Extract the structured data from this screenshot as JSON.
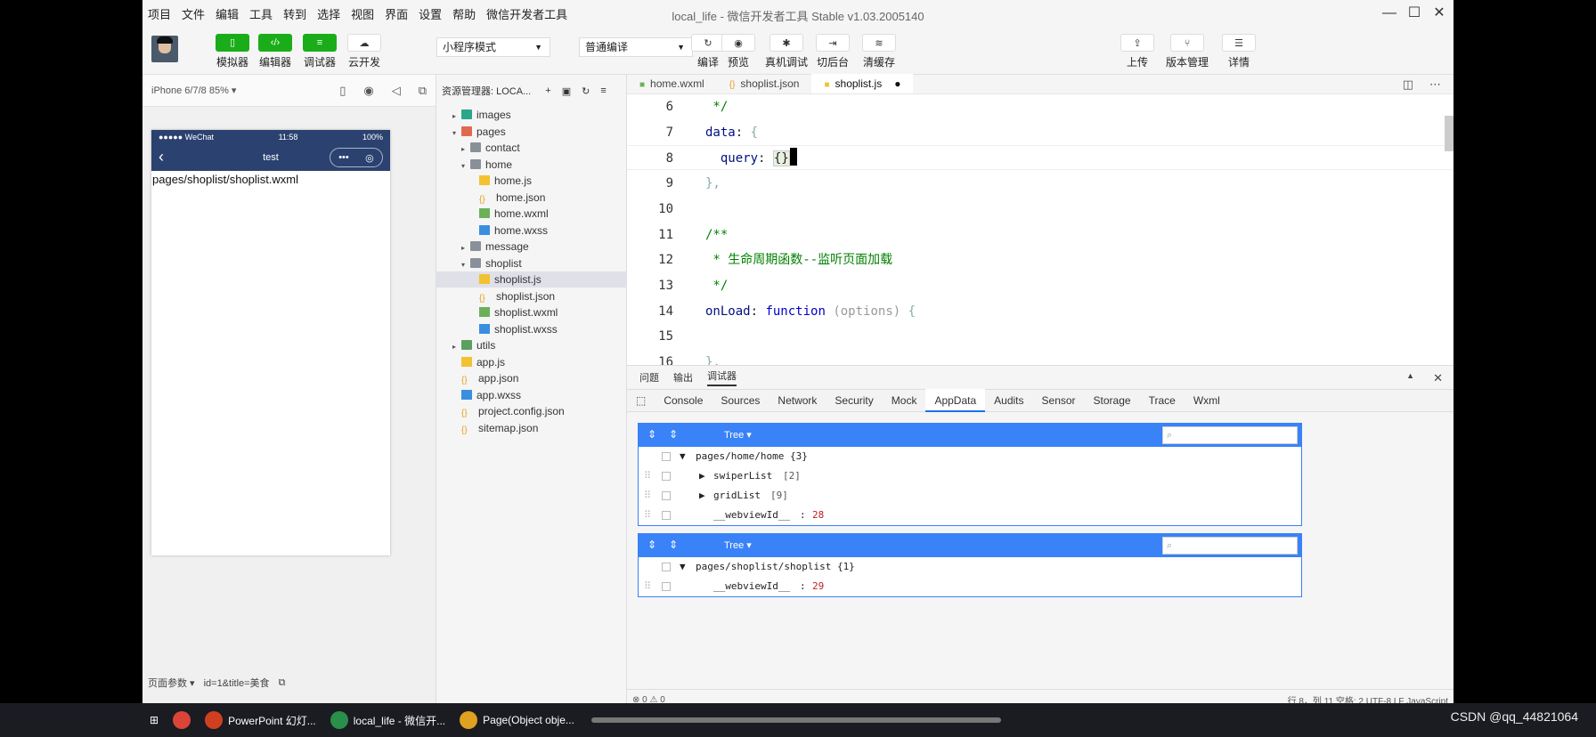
{
  "menu": [
    "项目",
    "文件",
    "编辑",
    "工具",
    "转到",
    "选择",
    "视图",
    "界面",
    "设置",
    "帮助",
    "微信开发者工具"
  ],
  "window_title": "local_life - 微信开发者工具 Stable v1.03.2005140",
  "toolbar": {
    "simulator": "模拟器",
    "editor": "编辑器",
    "debugger": "调试器",
    "cloud": "云开发",
    "mode": "小程序模式",
    "compile_mode": "普通编译",
    "compile": "编译",
    "preview": "预览",
    "real_debug": "真机调试",
    "background": "切后台",
    "clear_cache": "清缓存",
    "upload": "上传",
    "version": "版本管理",
    "details": "详情"
  },
  "simulator": {
    "device": "iPhone 6/7/8 85% ▾",
    "status_left": "●●●●● WeChat",
    "status_time": "11:58",
    "status_battery": "100%",
    "nav_title": "test",
    "page_path": "pages/shoplist/shoplist.wxml",
    "footer_label": "页面参数 ▾",
    "footer_query": "id=1&title=美食"
  },
  "explorer": {
    "title": "资源管理器: LOCA...",
    "items": [
      {
        "label": "images",
        "type": "fimg",
        "depth": 0,
        "arrow": "▸"
      },
      {
        "label": "pages",
        "type": "fpages",
        "depth": 0,
        "arrow": "▾"
      },
      {
        "label": "contact",
        "type": "folder",
        "depth": 1,
        "arrow": "▸"
      },
      {
        "label": "home",
        "type": "folder",
        "depth": 1,
        "arrow": "▾"
      },
      {
        "label": "home.js",
        "type": "js",
        "depth": 2,
        "arrow": ""
      },
      {
        "label": "home.json",
        "type": "json",
        "depth": 2,
        "arrow": ""
      },
      {
        "label": "home.wxml",
        "type": "wxml",
        "depth": 2,
        "arrow": ""
      },
      {
        "label": "home.wxss",
        "type": "wxss",
        "depth": 2,
        "arrow": ""
      },
      {
        "label": "message",
        "type": "folder",
        "depth": 1,
        "arrow": "▸"
      },
      {
        "label": "shoplist",
        "type": "folder",
        "depth": 1,
        "arrow": "▾"
      },
      {
        "label": "shoplist.js",
        "type": "js",
        "depth": 2,
        "arrow": "",
        "selected": true
      },
      {
        "label": "shoplist.json",
        "type": "json",
        "depth": 2,
        "arrow": ""
      },
      {
        "label": "shoplist.wxml",
        "type": "wxml",
        "depth": 2,
        "arrow": ""
      },
      {
        "label": "shoplist.wxss",
        "type": "wxss",
        "depth": 2,
        "arrow": ""
      },
      {
        "label": "utils",
        "type": "futils",
        "depth": 0,
        "arrow": "▸"
      },
      {
        "label": "app.js",
        "type": "js",
        "depth": 0,
        "arrow": ""
      },
      {
        "label": "app.json",
        "type": "json",
        "depth": 0,
        "arrow": ""
      },
      {
        "label": "app.wxss",
        "type": "wxss",
        "depth": 0,
        "arrow": ""
      },
      {
        "label": "project.config.json",
        "type": "json",
        "depth": 0,
        "arrow": ""
      },
      {
        "label": "sitemap.json",
        "type": "json",
        "depth": 0,
        "arrow": ""
      }
    ]
  },
  "editor": {
    "tabs": [
      {
        "label": "home.wxml",
        "icon": "wxml"
      },
      {
        "label": "shoplist.json",
        "icon": "json"
      },
      {
        "label": "shoplist.js",
        "icon": "js",
        "active": true,
        "modified": "●"
      }
    ],
    "lines": [
      {
        "n": "6",
        "html": "<span class='cm'> */</span>"
      },
      {
        "n": "7",
        "html": "<span class='pr'>data</span>: <span class='pu'>{</span>"
      },
      {
        "n": "8",
        "html": "  <span class='pr'>query</span>: <span class='br'>{}</span>",
        "hl": true
      },
      {
        "n": "9",
        "html": "<span class='pu'>},</span>"
      },
      {
        "n": "10",
        "html": ""
      },
      {
        "n": "11",
        "html": "<span class='cm'>/**</span>"
      },
      {
        "n": "12",
        "html": "<span class='cm'> * 生命周期函数--监听页面加载</span>"
      },
      {
        "n": "13",
        "html": "<span class='cm'> */</span>"
      },
      {
        "n": "14",
        "html": "<span class='pr'>onLoad</span>: <span class='kw'>function</span> <span class='pa'>(options)</span> <span class='pu'>{</span>"
      },
      {
        "n": "15",
        "html": ""
      },
      {
        "n": "16",
        "html": "<span class='pu'>},</span>"
      }
    ]
  },
  "panel": {
    "tabs": [
      "问题",
      "输出",
      "调试器"
    ],
    "devtools_tabs": [
      "Console",
      "Sources",
      "Network",
      "Security",
      "Mock",
      "AppData",
      "Audits",
      "Sensor",
      "Storage",
      "Trace",
      "Wxml"
    ],
    "active_devtool": "AppData",
    "tree_label": "Tree ▾",
    "box1": {
      "root": "pages/home/home {3}",
      "rows": [
        {
          "key": "swiperList",
          "val": "[2]",
          "arrow": "▶"
        },
        {
          "key": "gridList",
          "val": "[9]",
          "arrow": "▶"
        },
        {
          "key": "__webviewId__",
          "val": "28",
          "num": true
        }
      ]
    },
    "box2": {
      "root": "pages/shoplist/shoplist {1}",
      "rows": [
        {
          "key": "__webviewId__",
          "val": "29",
          "num": true
        }
      ]
    }
  },
  "status": {
    "problems": "⊗ 0 ⚠ 0",
    "right": "行 8，列 11   空格: 2   UTF-8   LF   JavaScript"
  },
  "taskbar": [
    {
      "label": "PowerPoint 幻灯...",
      "color": "#d04020"
    },
    {
      "label": "local_life - 微信开...",
      "color": "#2a8f4a"
    },
    {
      "label": "Page(Object obje...",
      "color": "#e0a020"
    }
  ],
  "watermark": "CSDN @qq_44821064",
  "colors": {
    "accent": "#1aad19",
    "devtools_blue": "#3a82f7",
    "nav_bar": "#2b4270"
  }
}
